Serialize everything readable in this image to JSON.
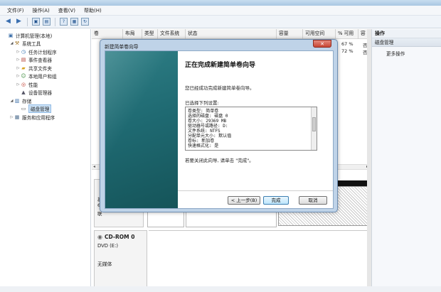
{
  "menu": [
    "文件(F)",
    "操作(A)",
    "查看(V)",
    "帮助(H)"
  ],
  "tree": [
    {
      "label": "计算机管理(本地)",
      "icon": "computer-icon",
      "level": 0,
      "arrow": ""
    },
    {
      "label": "系统工具",
      "icon": "tools-icon",
      "level": 1,
      "arrow": "◢"
    },
    {
      "label": "任务计划程序",
      "icon": "clock-icon",
      "level": 2,
      "arrow": "▷"
    },
    {
      "label": "事件查看器",
      "icon": "event-icon",
      "level": 2,
      "arrow": "▷"
    },
    {
      "label": "共享文件夹",
      "icon": "folder-icon",
      "level": 2,
      "arrow": "▷"
    },
    {
      "label": "本地用户和组",
      "icon": "users-icon",
      "level": 2,
      "arrow": "▷"
    },
    {
      "label": "性能",
      "icon": "performance-icon",
      "level": 2,
      "arrow": "▷"
    },
    {
      "label": "设备管理器",
      "icon": "device-icon",
      "level": 2,
      "arrow": ""
    },
    {
      "label": "存储",
      "icon": "storage-icon",
      "level": 1,
      "arrow": "◢"
    },
    {
      "label": "磁盘管理",
      "icon": "disk-icon",
      "level": 2,
      "arrow": "",
      "selected": true
    },
    {
      "label": "服务和应用程序",
      "icon": "services-icon",
      "level": 1,
      "arrow": "▷"
    }
  ],
  "columns": [
    "卷",
    "布局",
    "类型",
    "文件系统",
    "状态",
    "容量",
    "可用空间",
    "% 可用",
    "容"
  ],
  "volume_rows": [
    {
      "pct": "67 %",
      "flag": "否"
    },
    {
      "pct": "72 %",
      "flag": "否"
    }
  ],
  "disk0_labels": [
    "基",
    "6",
    "联"
  ],
  "cdrom": {
    "title": "CD-ROM 0",
    "drive": "DVD (E:)",
    "media": "无媒体"
  },
  "actions": {
    "header": "操作",
    "section": "磁盘管理",
    "more": "更多操作"
  },
  "wizard": {
    "window_title": "新建简单卷向导",
    "heading": "正在完成新建简单卷向导",
    "done_text": "您已经成功完成新建简单卷向导。",
    "chosen_label": "已选择下列设置:",
    "settings": [
      "卷类型: 简单卷",
      "选择的磁盘: 磁盘 0",
      "卷大小: 29369 MB",
      "驱动器号或路径: D:",
      "文件系统: NTFS",
      "分配单元大小: 默认值",
      "卷标: 新加卷",
      "快速格式化: 是"
    ],
    "close_note": "若要关闭此向导, 请单击 \"完成\"。",
    "back_label": "< 上一步(B)",
    "finish_label": "完成",
    "cancel_label": "取消"
  }
}
